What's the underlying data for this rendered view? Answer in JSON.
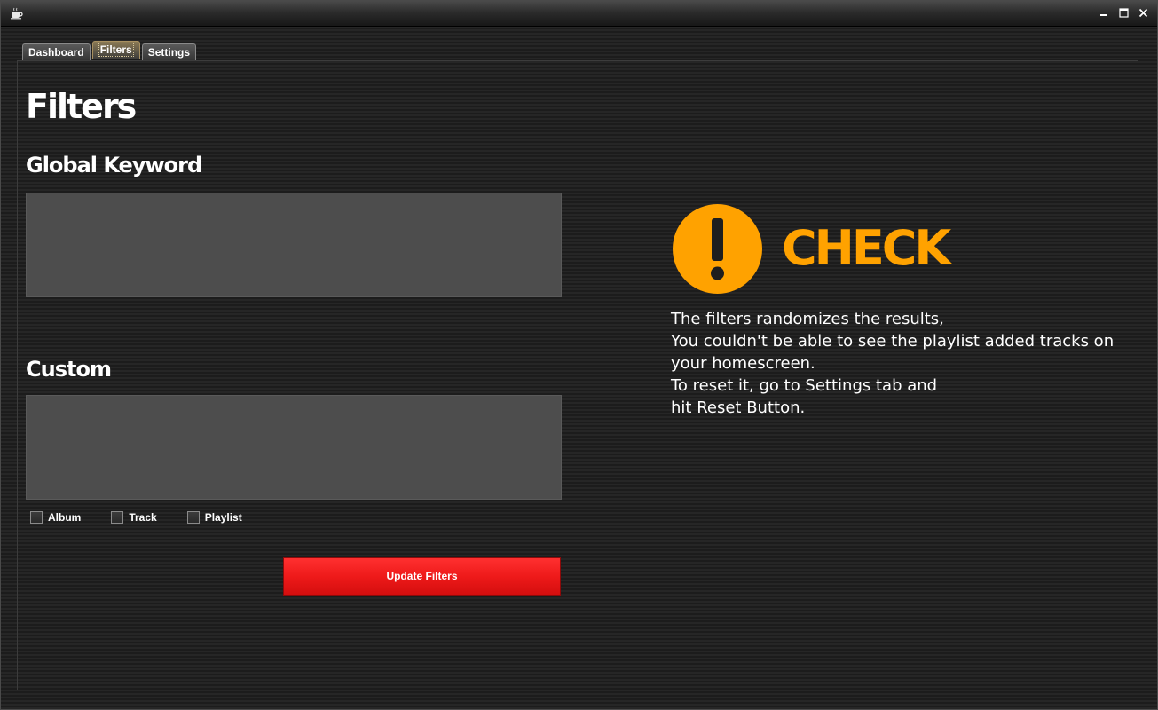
{
  "window": {
    "app_icon": "coffee-cup-icon",
    "controls": [
      "minimize-icon",
      "maximize-icon",
      "close-icon"
    ]
  },
  "tabs": [
    {
      "label": "Dashboard",
      "active": false
    },
    {
      "label": "Filters",
      "active": true
    },
    {
      "label": "Settings",
      "active": false
    }
  ],
  "page": {
    "title": "Filters"
  },
  "global_keyword": {
    "heading": "Global Keyword",
    "value": ""
  },
  "custom": {
    "heading": "Custom",
    "value": "",
    "options": [
      {
        "label": "Album",
        "checked": false
      },
      {
        "label": "Track",
        "checked": false
      },
      {
        "label": "Playlist",
        "checked": false
      }
    ]
  },
  "update_button": {
    "label": "Update Filters",
    "color": "#ee1a1a"
  },
  "notice": {
    "icon": "exclamation-circle-icon",
    "title": "CHECK",
    "accent_color": "#ffa200",
    "lines": [
      "The filters randomizes the results,",
      "You couldn't be able to see the playlist added tracks on",
      "your homescreen.",
      "To reset it, go to Settings tab and",
      "hit Reset Button."
    ]
  }
}
